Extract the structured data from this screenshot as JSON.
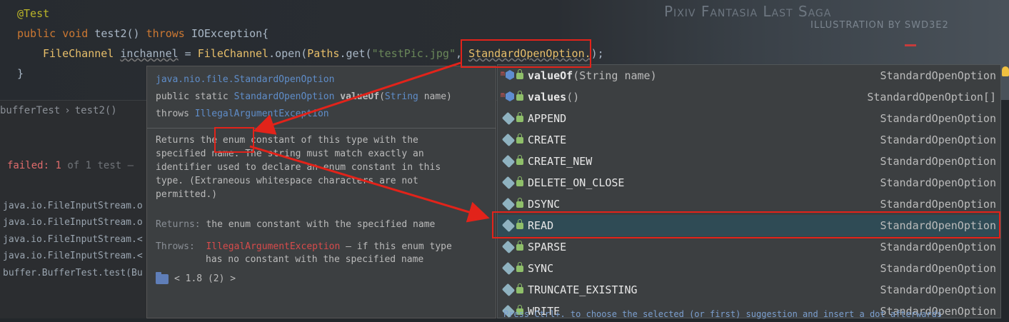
{
  "editor": {
    "line1": "@Test",
    "line2": {
      "kw1": "public",
      "kw2": "void",
      "name": "test2()",
      "kw3": "throws",
      "exc": "IOException{"
    },
    "line3": {
      "type1": "FileChannel",
      "var": "inchannel",
      "eq": " = ",
      "type2": "FileChannel",
      ".open(": ".open(",
      "paths": "Paths",
      ".get(": ".get(",
      "str": "\"testPic.jpg\"",
      "comma": ", ",
      "opt": "StandardOpenOption.",
      "end": ");"
    },
    "line4": "}",
    "watermark_title": "Pixiv Fantasia Last Saga",
    "watermark_sub": "ILLUSTRATION BY SWD3E2"
  },
  "breadcrumb": {
    "class_name": "bufferTest",
    "sep": "›",
    "method": "test2()"
  },
  "run_panel": {
    "failed_label": "failed:",
    "failed_count": "1",
    "of_text": "of 1 test –",
    "stack": [
      "java.io.FileInputStream.o",
      "java.io.FileInputStream.o",
      "java.io.FileInputStream.<",
      "java.io.FileInputStream.<",
      "buffer.BufferTest.test(Bu"
    ]
  },
  "doc": {
    "package": "java.nio.file.StandardOpenOption",
    "sig_mod": "public static ",
    "sig_type": "StandardOpenOption",
    "sig_name": "valueOf",
    "sig_params_open": "(",
    "sig_param_type": "String",
    "sig_param_name": " name)",
    "throws_kw": "throws ",
    "throws_type": "IllegalArgumentException",
    "body": "Returns the enum constant of this type with the specified name. The string must match exactly an identifier used to declare an enum constant in this type. (Extraneous whitespace characters are not permitted.)",
    "returns_label": "Returns:",
    "returns_text": "the enum constant with the specified name",
    "throws_label": "Throws:",
    "throws_exc": "IllegalArgumentException",
    "throws_text": "– if this enum type has no constant with the specified name",
    "footer": "< 1.8 (2) >"
  },
  "completion": {
    "items": [
      {
        "name": "valueOf",
        "params": "(String name)",
        "rtype": "StandardOpenOption",
        "kind": "method"
      },
      {
        "name": "values",
        "params": "()",
        "rtype": "StandardOpenOption[]",
        "kind": "method"
      },
      {
        "name": "APPEND",
        "params": "",
        "rtype": "StandardOpenOption",
        "kind": "enum"
      },
      {
        "name": "CREATE",
        "params": "",
        "rtype": "StandardOpenOption",
        "kind": "enum"
      },
      {
        "name": "CREATE_NEW",
        "params": "",
        "rtype": "StandardOpenOption",
        "kind": "enum"
      },
      {
        "name": "DELETE_ON_CLOSE",
        "params": "",
        "rtype": "StandardOpenOption",
        "kind": "enum"
      },
      {
        "name": "DSYNC",
        "params": "",
        "rtype": "StandardOpenOption",
        "kind": "enum"
      },
      {
        "name": "READ",
        "params": "",
        "rtype": "StandardOpenOption",
        "kind": "enum"
      },
      {
        "name": "SPARSE",
        "params": "",
        "rtype": "StandardOpenOption",
        "kind": "enum"
      },
      {
        "name": "SYNC",
        "params": "",
        "rtype": "StandardOpenOption",
        "kind": "enum"
      },
      {
        "name": "TRUNCATE_EXISTING",
        "params": "",
        "rtype": "StandardOpenOption",
        "kind": "enum"
      },
      {
        "name": "WRITE",
        "params": "",
        "rtype": "StandardOpenOption",
        "kind": "enum"
      }
    ],
    "selected_index": 7,
    "hint": "Press Ctrl+. to choose the selected (or first) suggestion and insert a dot afterwards"
  },
  "colors": {
    "annotation_red": "#e2231a",
    "selection": "#2f4b55"
  }
}
